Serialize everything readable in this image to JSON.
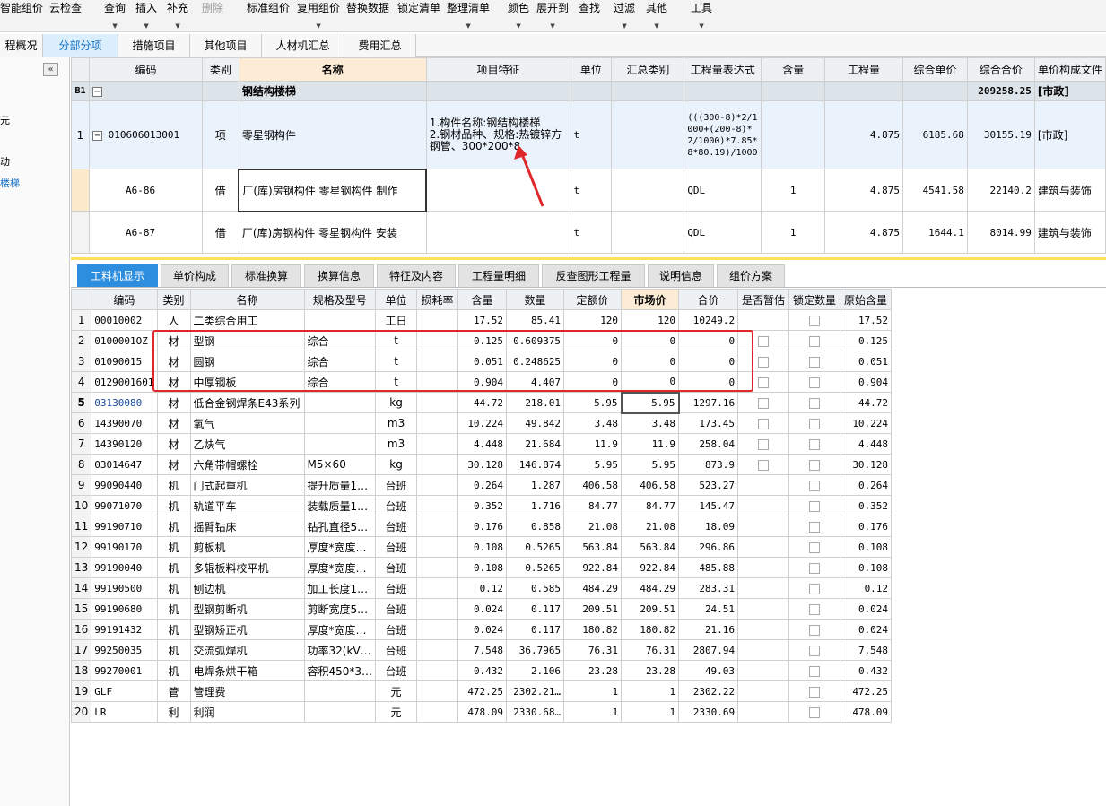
{
  "toolbar": {
    "items": [
      "智能组价",
      "云检查",
      "查询",
      "插入",
      "补充",
      "删除",
      "标准组价",
      "复用组价",
      "替换数据",
      "锁定清单",
      "整理清单",
      "颜色",
      "展开到",
      "查找",
      "过滤",
      "其他",
      "工具"
    ]
  },
  "top_tabs": [
    "程概况",
    "分部分项",
    "措施项目",
    "其他项目",
    "人材机汇总",
    "费用汇总"
  ],
  "sidebar": {
    "collapse": "«",
    "items": [
      "元",
      "动",
      "楼梯"
    ]
  },
  "colors": {
    "accent": "#2d8ee0",
    "annotation": "#e0272a",
    "selected_row": "#eaf2fc"
  },
  "upper_grid": {
    "headers": [
      "编码",
      "类别",
      "名称",
      "项目特征",
      "单位",
      "汇总类别",
      "工程量表达式",
      "含量",
      "工程量",
      "综合单价",
      "综合合价",
      "单价构成文件"
    ],
    "section": {
      "id": "B1",
      "toggle": "−",
      "name": "钢结构楼梯",
      "total": "209258.25",
      "file": "[市政]"
    },
    "item": {
      "no": "1",
      "toggle": "−",
      "code": "010606013001",
      "type": "项",
      "name": "零星钢构件",
      "feature_1": "1.构件名称:钢结构楼梯",
      "feature_2": "2.钢材品种、规格:热镀锌方钢管、300*200*8",
      "unit": "t",
      "expr": "(((300-8)*2/1000+(200-8)*2/1000)*7.85*8*80.19)/1000",
      "qty": "4.875",
      "unit_price": "6185.68",
      "total": "30155.19",
      "file": "[市政]"
    },
    "subs": [
      {
        "code": "A6-86",
        "type": "借",
        "name": "厂(库)房钢构件 零星钢构件 制作",
        "unit": "t",
        "expr": "QDL",
        "content": "1",
        "qty": "4.875",
        "unit_price": "4541.58",
        "total": "22140.2",
        "file": "建筑与装饰"
      },
      {
        "code": "A6-87",
        "type": "借",
        "name": "厂(库)房钢构件 零星钢构件 安装",
        "unit": "t",
        "expr": "QDL",
        "content": "1",
        "qty": "4.875",
        "unit_price": "1644.1",
        "total": "8014.99",
        "file": "建筑与装饰"
      }
    ]
  },
  "bottom_tabs": [
    "工料机显示",
    "单价构成",
    "标准换算",
    "换算信息",
    "特征及内容",
    "工程量明细",
    "反查图形工程量",
    "说明信息",
    "组价方案"
  ],
  "lower_grid": {
    "headers": [
      "编码",
      "类别",
      "名称",
      "规格及型号",
      "单位",
      "损耗率",
      "含量",
      "数量",
      "定额价",
      "市场价",
      "合价",
      "是否暂估",
      "锁定数量",
      "原始含量"
    ],
    "rows": [
      {
        "no": "1",
        "code": "00010002",
        "type": "人",
        "name": "二类综合用工",
        "spec": "",
        "unit": "工日",
        "content": "17.52",
        "amount": "85.41",
        "base": "120",
        "market": "120",
        "total": "10249.2",
        "check": false,
        "orig": "17.52"
      },
      {
        "no": "2",
        "code": "0100001OZ",
        "type": "材",
        "name": "型钢",
        "spec": "综合",
        "unit": "t",
        "content": "0.125",
        "amount": "0.609375",
        "base": "0",
        "market": "0",
        "total": "0",
        "check": true,
        "orig": "0.125"
      },
      {
        "no": "3",
        "code": "01090015",
        "type": "材",
        "name": "圆钢",
        "spec": "综合",
        "unit": "t",
        "content": "0.051",
        "amount": "0.248625",
        "base": "0",
        "market": "0",
        "total": "0",
        "check": true,
        "orig": "0.051"
      },
      {
        "no": "4",
        "code": "0129001601",
        "type": "材",
        "name": "中厚钢板",
        "spec": "综合",
        "unit": "t",
        "content": "0.904",
        "amount": "4.407",
        "base": "0",
        "market": "0",
        "total": "0",
        "check": true,
        "orig": "0.904"
      },
      {
        "no": "5",
        "code": "03130080",
        "type": "材",
        "name": "低合金钢焊条E43系列",
        "spec": "",
        "unit": "kg",
        "content": "44.72",
        "amount": "218.01",
        "base": "5.95",
        "market": "5.95",
        "total": "1297.16",
        "check": true,
        "orig": "44.72"
      },
      {
        "no": "6",
        "code": "14390070",
        "type": "材",
        "name": "氧气",
        "spec": "",
        "unit": "m3",
        "content": "10.224",
        "amount": "49.842",
        "base": "3.48",
        "market": "3.48",
        "total": "173.45",
        "check": true,
        "orig": "10.224"
      },
      {
        "no": "7",
        "code": "14390120",
        "type": "材",
        "name": "乙炔气",
        "spec": "",
        "unit": "m3",
        "content": "4.448",
        "amount": "21.684",
        "base": "11.9",
        "market": "11.9",
        "total": "258.04",
        "check": true,
        "orig": "4.448"
      },
      {
        "no": "8",
        "code": "03014647",
        "type": "材",
        "name": "六角带帽螺栓",
        "spec": "M5×60",
        "unit": "kg",
        "content": "30.128",
        "amount": "146.874",
        "base": "5.95",
        "market": "5.95",
        "total": "873.9",
        "check": true,
        "orig": "30.128"
      },
      {
        "no": "9",
        "code": "99090440",
        "type": "机",
        "name": "门式起重机",
        "spec": "提升质量1…",
        "unit": "台班",
        "content": "0.264",
        "amount": "1.287",
        "base": "406.58",
        "market": "406.58",
        "total": "523.27",
        "check": false,
        "orig": "0.264"
      },
      {
        "no": "10",
        "code": "99071070",
        "type": "机",
        "name": "轨道平车",
        "spec": "装载质量1…",
        "unit": "台班",
        "content": "0.352",
        "amount": "1.716",
        "base": "84.77",
        "market": "84.77",
        "total": "145.47",
        "check": false,
        "orig": "0.352"
      },
      {
        "no": "11",
        "code": "99190710",
        "type": "机",
        "name": "摇臂钻床",
        "spec": "钻孔直径5…",
        "unit": "台班",
        "content": "0.176",
        "amount": "0.858",
        "base": "21.08",
        "market": "21.08",
        "total": "18.09",
        "check": false,
        "orig": "0.176"
      },
      {
        "no": "12",
        "code": "99190170",
        "type": "机",
        "name": "剪板机",
        "spec": "厚度*宽度…",
        "unit": "台班",
        "content": "0.108",
        "amount": "0.5265",
        "base": "563.84",
        "market": "563.84",
        "total": "296.86",
        "check": false,
        "orig": "0.108"
      },
      {
        "no": "13",
        "code": "99190040",
        "type": "机",
        "name": "多辊板料校平机",
        "spec": "厚度*宽度…",
        "unit": "台班",
        "content": "0.108",
        "amount": "0.5265",
        "base": "922.84",
        "market": "922.84",
        "total": "485.88",
        "check": false,
        "orig": "0.108"
      },
      {
        "no": "14",
        "code": "99190500",
        "type": "机",
        "name": "刨边机",
        "spec": "加工长度1…",
        "unit": "台班",
        "content": "0.12",
        "amount": "0.585",
        "base": "484.29",
        "market": "484.29",
        "total": "283.31",
        "check": false,
        "orig": "0.12"
      },
      {
        "no": "15",
        "code": "99190680",
        "type": "机",
        "name": "型钢剪断机",
        "spec": "剪断宽度5…",
        "unit": "台班",
        "content": "0.024",
        "amount": "0.117",
        "base": "209.51",
        "market": "209.51",
        "total": "24.51",
        "check": false,
        "orig": "0.024"
      },
      {
        "no": "16",
        "code": "99191432",
        "type": "机",
        "name": "型钢矫正机",
        "spec": "厚度*宽度…",
        "unit": "台班",
        "content": "0.024",
        "amount": "0.117",
        "base": "180.82",
        "market": "180.82",
        "total": "21.16",
        "check": false,
        "orig": "0.024"
      },
      {
        "no": "17",
        "code": "99250035",
        "type": "机",
        "name": "交流弧焊机",
        "spec": "功率32(kV…",
        "unit": "台班",
        "content": "7.548",
        "amount": "36.7965",
        "base": "76.31",
        "market": "76.31",
        "total": "2807.94",
        "check": false,
        "orig": "7.548"
      },
      {
        "no": "18",
        "code": "99270001",
        "type": "机",
        "name": "电焊条烘干箱",
        "spec": "容积450*3…",
        "unit": "台班",
        "content": "0.432",
        "amount": "2.106",
        "base": "23.28",
        "market": "23.28",
        "total": "49.03",
        "check": false,
        "orig": "0.432"
      },
      {
        "no": "19",
        "code": "GLF",
        "type": "管",
        "name": "管理费",
        "spec": "",
        "unit": "元",
        "content": "472.25",
        "amount": "2302.21…",
        "base": "1",
        "market": "1",
        "total": "2302.22",
        "check": false,
        "orig": "472.25"
      },
      {
        "no": "20",
        "code": "LR",
        "type": "利",
        "name": "利润",
        "spec": "",
        "unit": "元",
        "content": "478.09",
        "amount": "2330.68…",
        "base": "1",
        "market": "1",
        "total": "2330.69",
        "check": false,
        "orig": "478.09"
      }
    ]
  }
}
